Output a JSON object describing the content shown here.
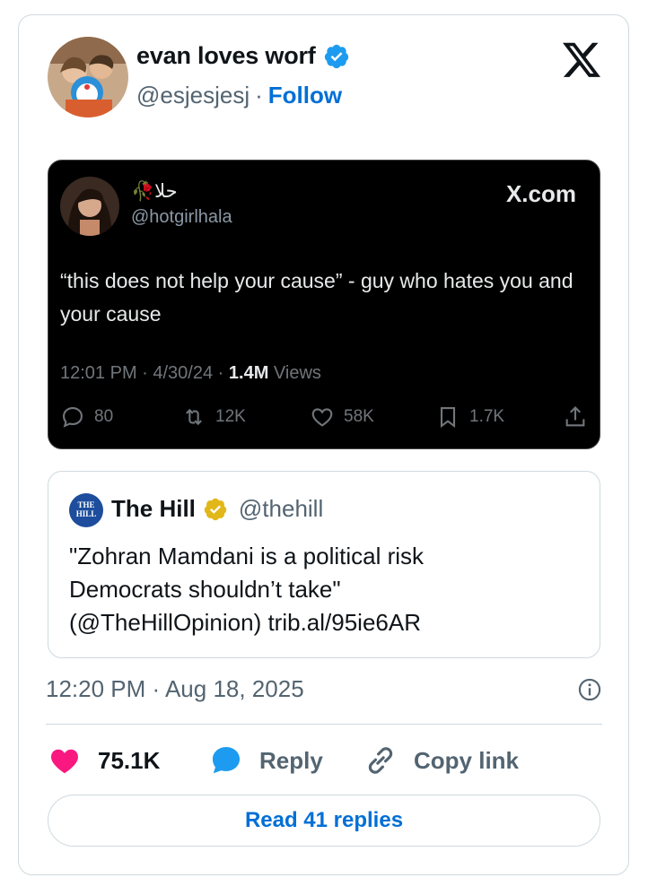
{
  "author": {
    "name": "evan loves worf",
    "handle": "@esjesjesj",
    "separator": "·",
    "follow_label": "Follow"
  },
  "embedded_tweet": {
    "name": "حلا🥀",
    "handle": "@hotgirlhala",
    "source": "X.com",
    "text": "“this does not help your cause” - guy who hates you and your cause",
    "time": "12:01 PM · 4/30/24 · ",
    "views_count": "1.4M",
    "views_label": " Views",
    "replies": "80",
    "reposts": "12K",
    "likes": "58K",
    "bookmarks": "1.7K"
  },
  "quoted_tweet": {
    "name": "The Hill",
    "handle": "@thehill",
    "logo_text": "THE HILL",
    "line1": "\"Zohran Mamdani is a political risk",
    "line2": "Democrats shouldn’t take\"",
    "line3": "(@TheHillOpinion)  trib.al/95ie6AR"
  },
  "timestamp": "12:20 PM · Aug 18, 2025",
  "actions": {
    "likes": "75.1K",
    "reply_label": "Reply",
    "copy_label": "Copy link"
  },
  "read_replies_label": "Read 41 replies",
  "colors": {
    "accent": "#006fd6",
    "heart": "#f91880",
    "reply_bubble": "#1d9bf0",
    "verified": "#1d9bf0",
    "verified_gold": "#e2b719"
  }
}
